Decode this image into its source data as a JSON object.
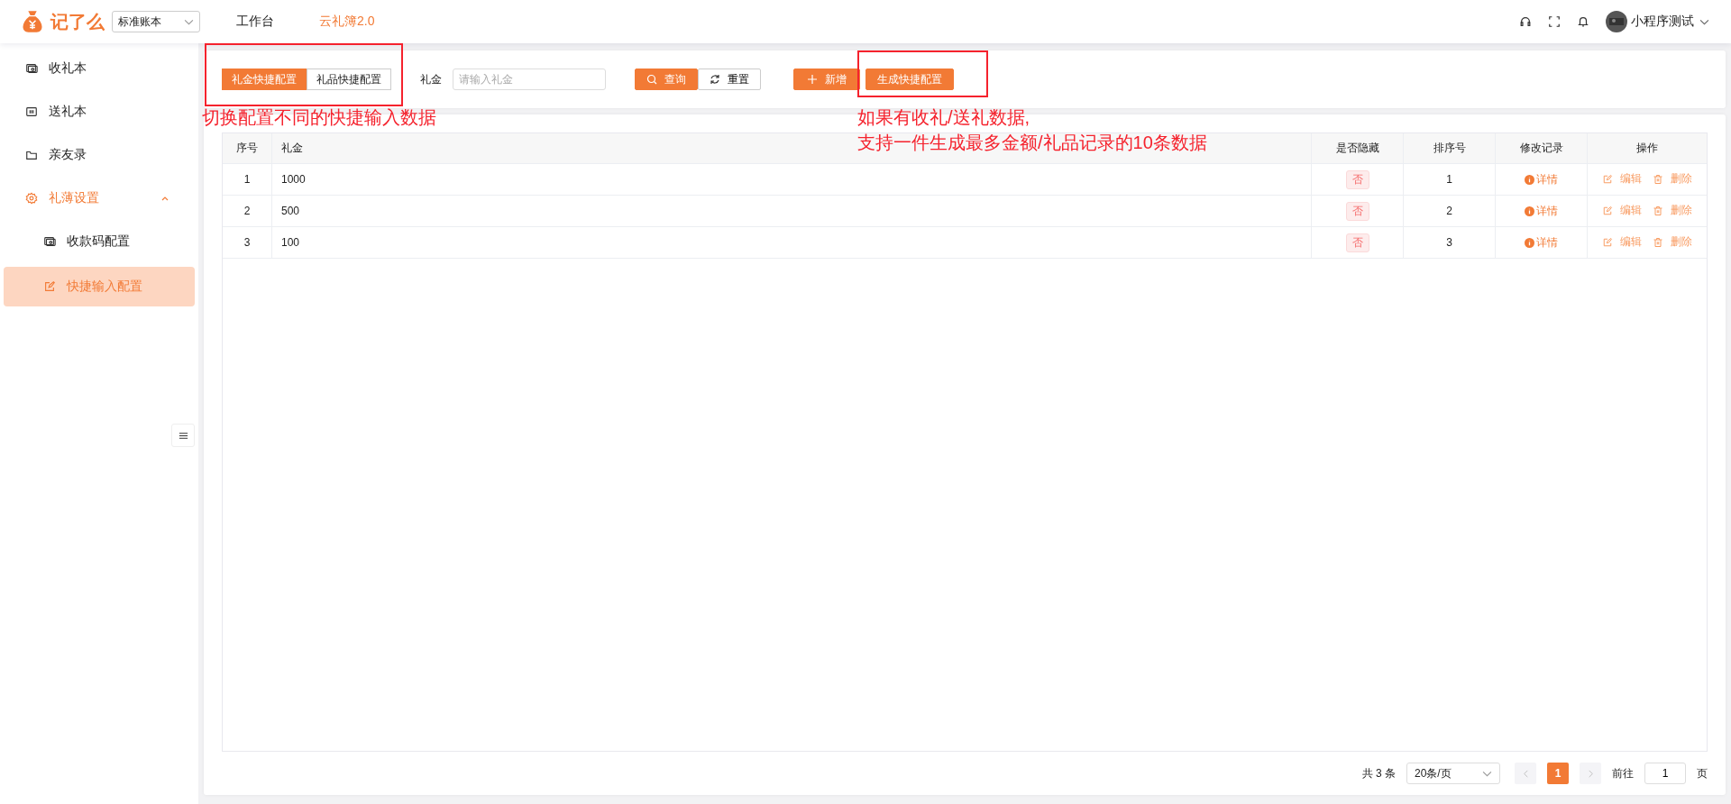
{
  "header": {
    "logo": "记了么",
    "book_select": "标准账本",
    "nav": [
      {
        "label": "工作台",
        "selected": false
      },
      {
        "label": "云礼簿2.0",
        "selected": true
      }
    ],
    "user": "小程序测试"
  },
  "sidebar": {
    "items": [
      {
        "label": "收礼本",
        "selected": false
      },
      {
        "label": "送礼本",
        "selected": false
      },
      {
        "label": "亲友录",
        "selected": false
      },
      {
        "label": "礼薄设置",
        "selected": true,
        "expanded": true,
        "children": [
          {
            "label": "收款码配置",
            "selected": false
          },
          {
            "label": "快捷输入配置",
            "selected": true
          }
        ]
      }
    ]
  },
  "toolbar": {
    "tabs": [
      {
        "label": "礼金快捷配置",
        "selected": true
      },
      {
        "label": "礼品快捷配置",
        "selected": false
      }
    ],
    "field_label": "礼金",
    "placeholder": "请输入礼金",
    "query": "查询",
    "reset": "重置",
    "add": "新增",
    "generate": "生成快捷配置"
  },
  "table": {
    "columns": [
      "序号",
      "礼金",
      "是否隐藏",
      "排序号",
      "修改记录",
      "操作"
    ],
    "rows": [
      {
        "index": "1",
        "amount": "1000",
        "hidden": "否",
        "order": "1",
        "record": "详情",
        "edit": "编辑",
        "delete": "删除"
      },
      {
        "index": "2",
        "amount": "500",
        "hidden": "否",
        "order": "2",
        "record": "详情",
        "edit": "编辑",
        "delete": "删除"
      },
      {
        "index": "3",
        "amount": "100",
        "hidden": "否",
        "order": "3",
        "record": "详情",
        "edit": "编辑",
        "delete": "删除"
      }
    ]
  },
  "pagination": {
    "total": "共 3 条",
    "page_size": "20条/页",
    "pages": [
      {
        "label": "1",
        "selected": true
      }
    ],
    "goto_label": "前往",
    "goto_value": "1",
    "page_unit": "页"
  },
  "annotations": [
    {
      "kind": "box"
    },
    {
      "kind": "box"
    },
    {
      "kind": "note",
      "lines": [
        "切换配置不同的快捷输入数据"
      ]
    },
    {
      "kind": "note",
      "lines": [
        "如果有收礼/送礼数据,",
        "支持一件生成最多金额/礼品记录的10条数据"
      ]
    }
  ]
}
